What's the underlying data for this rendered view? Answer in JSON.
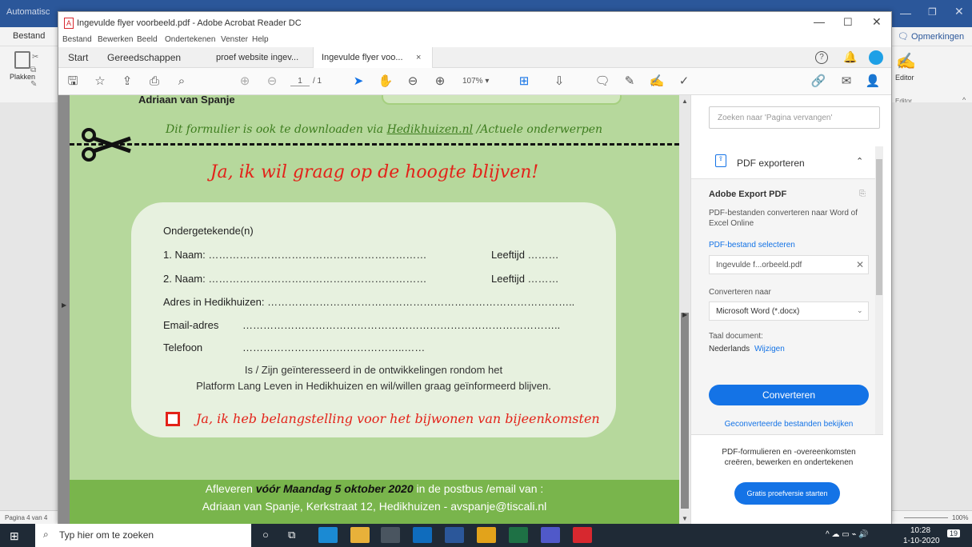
{
  "word": {
    "title": "Automatisc",
    "tab_bestand": "Bestand",
    "opmerkingen": "Opmerkingen",
    "plakken": "Plakken",
    "editor": "Editor",
    "editor_group": "Editor",
    "status_left": "Pagina 4 van 4",
    "zoom": "100%"
  },
  "acrobat": {
    "title": "Ingevulde flyer voorbeeld.pdf - Adobe Acrobat Reader DC",
    "menu": [
      "Bestand",
      "Bewerken",
      "Beeld",
      "Ondertekenen",
      "Venster",
      "Help"
    ],
    "tabs": [
      {
        "label": "Start"
      },
      {
        "label": "Gereedschappen"
      },
      {
        "label": "proef website ingev..."
      },
      {
        "label": "Ingevulde flyer voo..."
      }
    ],
    "tab_close": "×",
    "page_current": "1",
    "page_total": "/ 1",
    "zoom": "107%"
  },
  "document": {
    "top_name": "Adriaan van Spanje",
    "download_note_prefix": "Dit formulier is ook te downloaden via ",
    "download_link": "Hedikhuizen.nl",
    "download_note_suffix": " /Actuele onderwerpen",
    "heading": "Ja, ik wil graag op de hoogte blijven!",
    "ondergetekende": "Ondergetekende(n)",
    "naam1": "1.  Naam: ………………………………………………………",
    "leeftijd1": "Leeftijd ………",
    "naam2": "2.  Naam: ………………………………………………………",
    "leeftijd2": "Leeftijd ………",
    "adres": "Adres in Hedikhuizen: ……………………………………………………………………………..",
    "email_label": "Email-adres",
    "email_dots": "………………………………………………………………………………..",
    "telefoon_label": "Telefoon",
    "telefoon_dots": "………………………………………..……",
    "interest_line1": "Is / Zijn geïnteresseerd in de ontwikkelingen rondom het",
    "interest_line2": "Platform Lang Leven in Hedikhuizen en wil/willen graag geïnformeerd blijven.",
    "checkbox_label": "Ja, ik heb belangstelling voor het bijwonen van bijeenkomsten",
    "footer_prefix": "Afleveren ",
    "footer_bold": "vóór Maandag 5 oktober 2020",
    "footer_suffix": " in de postbus /email van :",
    "footer_line2": "Adriaan van Spanje, Kerkstraat 12, Hedikhuizen   -   avspanje@tiscali.nl"
  },
  "sidepanel": {
    "search_placeholder": "Zoeken naar 'Pagina vervangen'",
    "export_title": "PDF exporteren",
    "adobe_export": "Adobe Export PDF",
    "description": "PDF-bestanden converteren naar Word of Excel Online",
    "select_file": "PDF-bestand selecteren",
    "file_name": "Ingevulde f...orbeeld.pdf",
    "convert_to_label": "Converteren naar",
    "convert_to_value": "Microsoft Word (*.docx)",
    "language_label": "Taal document:",
    "language_value": "Nederlands",
    "language_change": "Wijzigen",
    "convert_button": "Converteren",
    "converted_link": "Geconverteerde bestanden bekijken",
    "promo_text": "PDF-formulieren en -overeenkomsten creëren, bewerken en ondertekenen",
    "trial_button": "Gratis proefversie starten"
  },
  "taskbar": {
    "search_placeholder": "Typ hier om te zoeken",
    "time": "10:28",
    "date": "1-10-2020",
    "notifications": "19"
  },
  "colors": {
    "acrobat_red": "#d7282f",
    "page_green": "#b6d89c",
    "footer_green": "#79b54c",
    "heading_red": "#e32219",
    "link_blue": "#1473e6"
  }
}
